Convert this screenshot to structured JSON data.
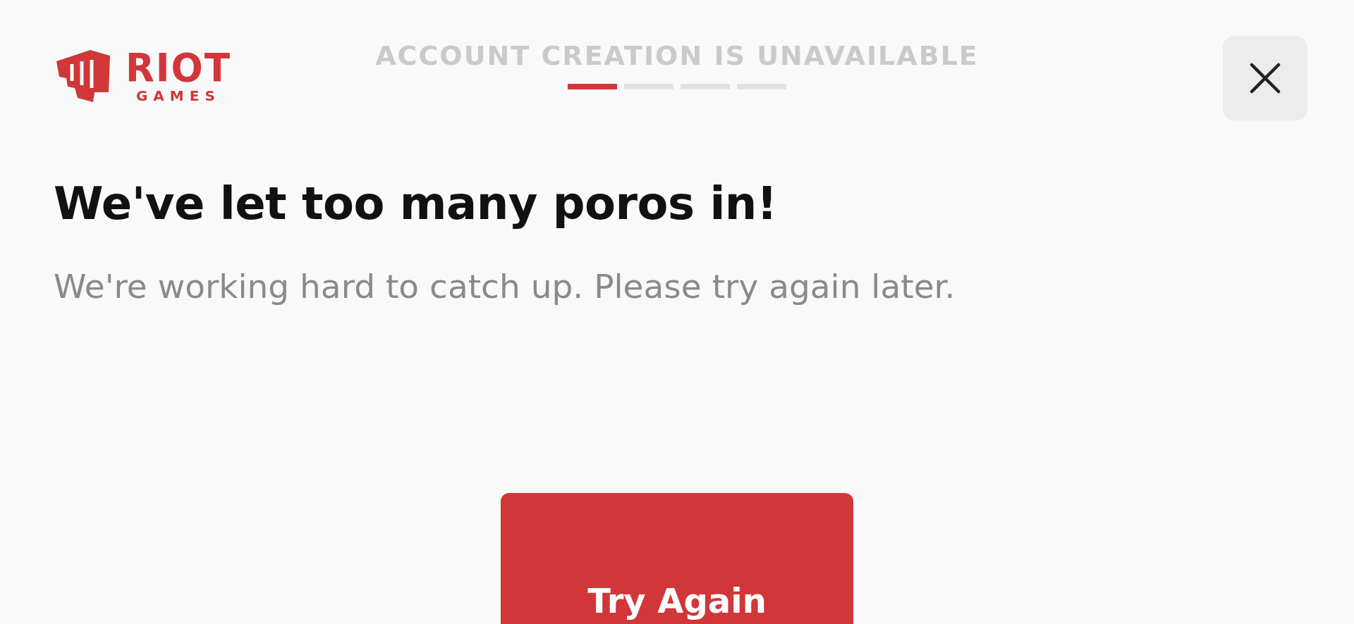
{
  "logo": {
    "line_1": "RIOT",
    "line_2": "GAMES"
  },
  "header": {
    "title": "ACCOUNT CREATION IS UNAVAILABLE",
    "steps": [
      {
        "selected": true
      },
      {
        "selected": false
      },
      {
        "selected": false
      },
      {
        "selected": false
      }
    ]
  },
  "heading": "We've let too many poros in!",
  "message": "We're working hard to catch up. Please try again later.",
  "button": "Try Again"
}
